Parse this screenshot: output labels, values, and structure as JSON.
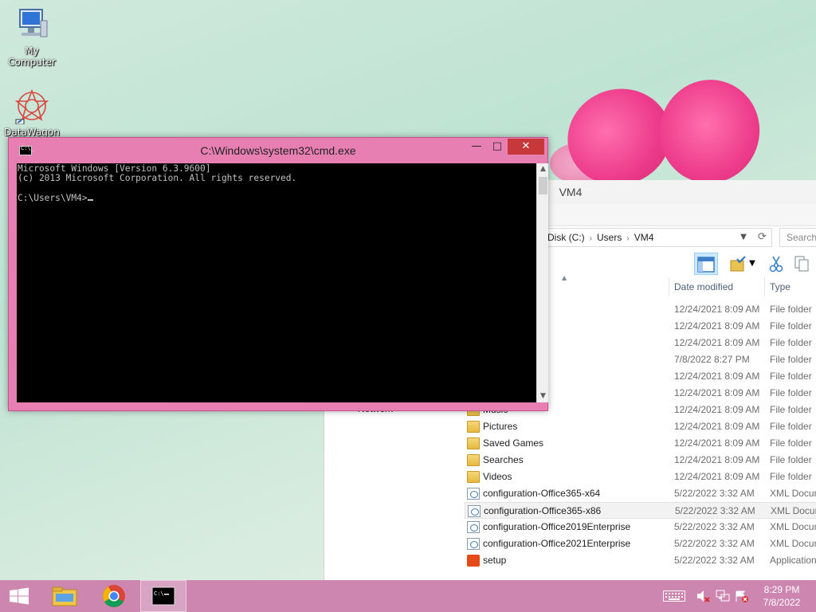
{
  "desktop": {
    "icons": [
      {
        "label": "My Computer",
        "icon": "computer-icon"
      },
      {
        "label": "DataWagon",
        "icon": "datawagon-icon"
      }
    ]
  },
  "cmd": {
    "title": "C:\\Windows\\system32\\cmd.exe",
    "lines": [
      "Microsoft Windows [Version 6.3.9600]",
      "(c) 2013 Microsoft Corporation. All rights reserved.",
      "",
      "C:\\Users\\VM4>"
    ],
    "buttons": {
      "minimize": "—",
      "maximize": "□",
      "close": "✕"
    }
  },
  "explorer": {
    "title": "VM4",
    "address": {
      "segments": [
        "Disk (C:)",
        "Users",
        "VM4"
      ]
    },
    "search_placeholder": "Search",
    "columns": {
      "date": "Date modified",
      "type": "Type"
    },
    "nav_partial": "Network",
    "rows": [
      {
        "name": "",
        "date": "12/24/2021 8:09 AM",
        "type": "File folder",
        "icon": "folder-icon"
      },
      {
        "name": "",
        "date": "12/24/2021 8:09 AM",
        "type": "File folder",
        "icon": "folder-icon"
      },
      {
        "name": "",
        "date": "12/24/2021 8:09 AM",
        "type": "File folder",
        "icon": "folder-icon"
      },
      {
        "name": "",
        "date": "7/8/2022 8:27 PM",
        "type": "File folder",
        "icon": "folder-icon"
      },
      {
        "name": "",
        "date": "12/24/2021 8:09 AM",
        "type": "File folder",
        "icon": "folder-icon"
      },
      {
        "name": "",
        "date": "12/24/2021 8:09 AM",
        "type": "File folder",
        "icon": "folder-icon"
      },
      {
        "name": "Music",
        "date": "12/24/2021 8:09 AM",
        "type": "File folder",
        "icon": "folder-icon"
      },
      {
        "name": "Pictures",
        "date": "12/24/2021 8:09 AM",
        "type": "File folder",
        "icon": "folder-icon"
      },
      {
        "name": "Saved Games",
        "date": "12/24/2021 8:09 AM",
        "type": "File folder",
        "icon": "folder-icon"
      },
      {
        "name": "Searches",
        "date": "12/24/2021 8:09 AM",
        "type": "File folder",
        "icon": "folder-icon"
      },
      {
        "name": "Videos",
        "date": "12/24/2021 8:09 AM",
        "type": "File folder",
        "icon": "folder-icon"
      },
      {
        "name": "configuration-Office365-x64",
        "date": "5/22/2022 3:32 AM",
        "type": "XML Docum",
        "icon": "xml-icon"
      },
      {
        "name": "configuration-Office365-x86",
        "date": "5/22/2022 3:32 AM",
        "type": "XML Docum",
        "icon": "xml-icon",
        "highlighted": true
      },
      {
        "name": "configuration-Office2019Enterprise",
        "date": "5/22/2022 3:32 AM",
        "type": "XML Docum",
        "icon": "xml-icon"
      },
      {
        "name": "configuration-Office2021Enterprise",
        "date": "5/22/2022 3:32 AM",
        "type": "XML Docum",
        "icon": "xml-icon"
      },
      {
        "name": "setup",
        "date": "5/22/2022 3:32 AM",
        "type": "Application",
        "icon": "office-icon"
      }
    ]
  },
  "taskbar": {
    "items": [
      {
        "name": "file-explorer",
        "icon": "folder-icon"
      },
      {
        "name": "chrome",
        "icon": "chrome-icon"
      },
      {
        "name": "cmd",
        "icon": "cmd-icon",
        "active": true
      }
    ],
    "clock": {
      "time": "8:29 PM",
      "date": "7/8/2022"
    }
  },
  "colors": {
    "taskbar": "#cc86b0",
    "cmd_frame": "#e77fb3",
    "close": "#c7383b"
  }
}
